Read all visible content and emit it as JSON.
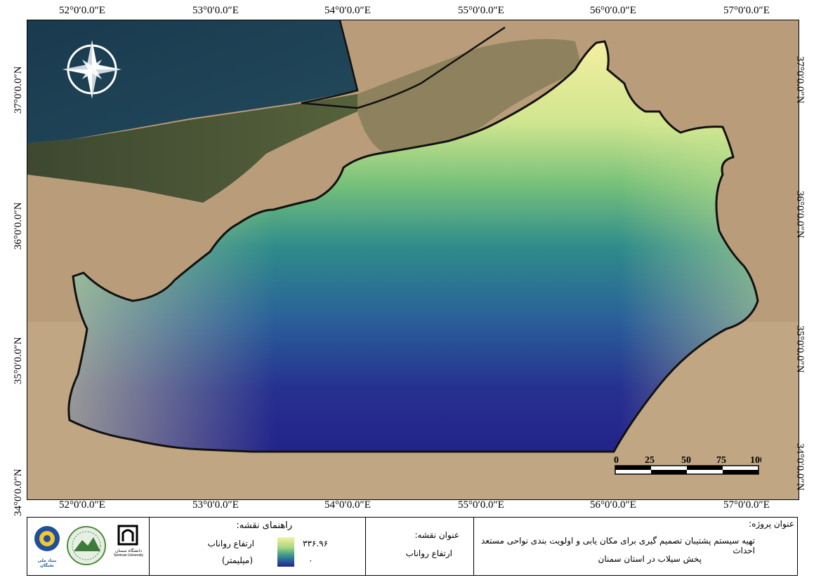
{
  "map": {
    "top_ticks": [
      "52°0′0.0″E",
      "53°0′0.0″E",
      "54°0′0.0″E",
      "55°0′0.0″E",
      "56°0′0.0″E",
      "57°0′0.0″E"
    ],
    "bottom_ticks": [
      "52°0′0.0″E",
      "53°0′0.0″E",
      "54°0′0.0″E",
      "55°0′0.0″E",
      "56°0′0.0″E",
      "57°0′0.0″E"
    ],
    "left_ticks": [
      "37°0′0.0″N",
      "36°0′0.0″N",
      "35°0′0.0″N",
      "34°0′0.0″N"
    ],
    "right_ticks": [
      "37°0′0.0″N",
      "36°0′0.0″N",
      "35°0′0.0″N",
      "34°0′0.0″N"
    ],
    "scale": {
      "labels": [
        "0",
        "25",
        "50",
        "75",
        "100 km"
      ]
    },
    "ramp_colors": {
      "high": "#f7f1a3",
      "mid": "#3d9a8b",
      "low": "#22238c"
    },
    "north_arrow_icon": "compass-rose-icon"
  },
  "legend": {
    "title": "راهنمای نقشه:",
    "variable": "ارتفاع رواناب",
    "unit": "(میلیمتر)",
    "max_value": "۳۳۶.۹۶",
    "min_value": "۰"
  },
  "map_title": {
    "label": "عنوان نقشه:",
    "value": "ارتفاع رواناب"
  },
  "project": {
    "label": "عنوان پروژه:",
    "line1": "تهیه سیستم پشتیبان تصمیم گیری برای مکان یابی و اولویت بندی نواحی مستعد احداث",
    "line2": "پخش سیلاب در استان سمنان"
  },
  "logos": {
    "nokhbegan": "بنیاد ملی نخبگان",
    "university_fa": "دانشگاه سمنان",
    "university_en": "Semnan University"
  }
}
